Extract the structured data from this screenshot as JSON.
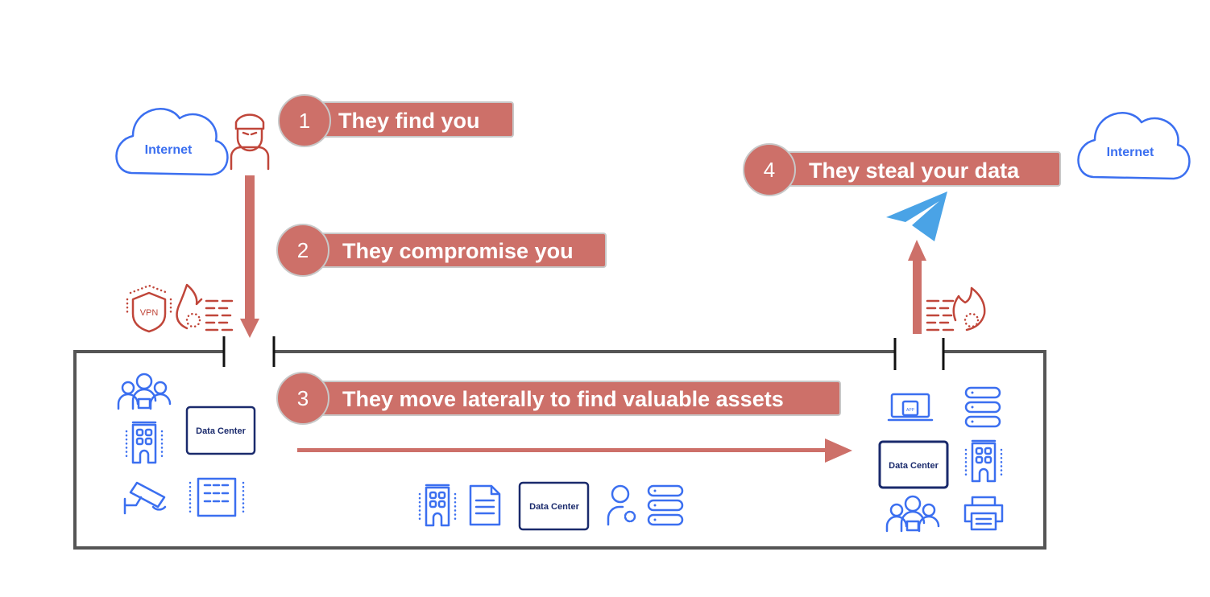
{
  "colors": {
    "accent": "#cd7069",
    "blue": "#3b6ff0",
    "navy": "#1a2a6c",
    "threat": "#c0463a",
    "boundary": "#555555"
  },
  "clouds": [
    {
      "label": "Internet"
    },
    {
      "label": "Internet"
    }
  ],
  "steps": [
    {
      "number": "1",
      "label": "They find you"
    },
    {
      "number": "2",
      "label": "They compromise you"
    },
    {
      "number": "3",
      "label": "They move laterally to find valuable assets"
    },
    {
      "number": "4",
      "label": "They steal your data"
    }
  ],
  "perimeter_left": {
    "vpn_label": "VPN",
    "icons": [
      "vpn-shield-icon",
      "firewall-icon"
    ]
  },
  "perimeter_right": {
    "icons": [
      "firewall-icon"
    ]
  },
  "data_centers": [
    {
      "label": "Data Center"
    },
    {
      "label": "Data Center"
    },
    {
      "label": "Data Center"
    }
  ],
  "app_label": "APP",
  "exfil_icon": "telegram-paper-plane-icon"
}
